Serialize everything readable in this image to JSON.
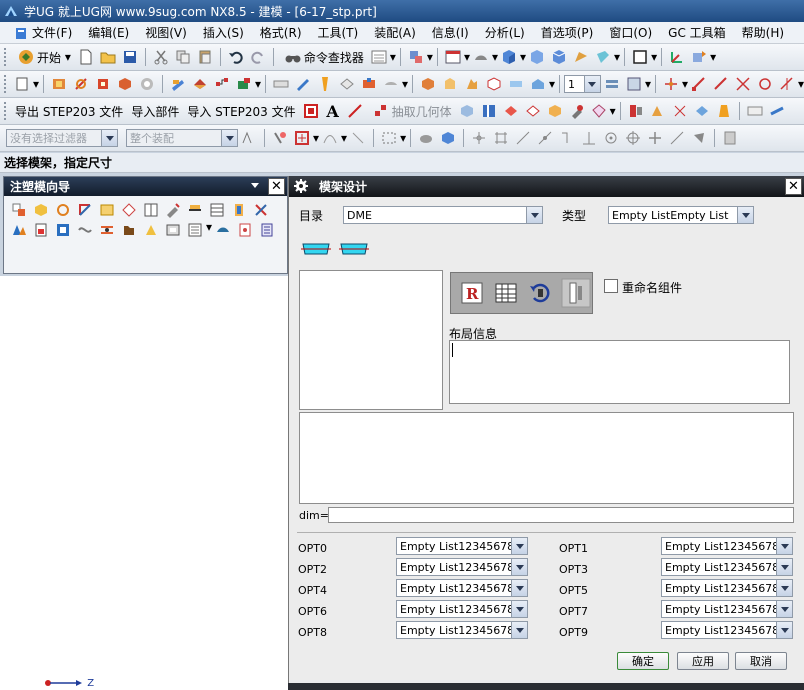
{
  "titlebar": {
    "text": "学UG 就上UG网  www.9sug.com NX8.5 - 建模 - [6-17_stp.prt]"
  },
  "menu": [
    {
      "label": "文件(F)"
    },
    {
      "label": "编辑(E)"
    },
    {
      "label": "视图(V)"
    },
    {
      "label": "插入(S)"
    },
    {
      "label": "格式(R)"
    },
    {
      "label": "工具(T)"
    },
    {
      "label": "装配(A)"
    },
    {
      "label": "信息(I)"
    },
    {
      "label": "分析(L)"
    },
    {
      "label": "首选项(P)"
    },
    {
      "label": "窗口(O)"
    },
    {
      "label": "GC 工具箱"
    },
    {
      "label": "帮助(H)"
    }
  ],
  "toolbar1": {
    "start": "开始",
    "command_finder": "命令查找器"
  },
  "toolbar2": {
    "layer_value": "1"
  },
  "toolbar3": {
    "export_step": "导出 STEP203 文件",
    "import_part": "导入部件",
    "import_step": "导入 STEP203 文件",
    "extract_geometry": "抽取几何体"
  },
  "toolbar4": {
    "filter_placeholder": "没有选择过滤器",
    "assembly_scope": "整个装配"
  },
  "status": {
    "prompt": "选择模架，指定尺寸"
  },
  "navigator": {
    "title": "注塑模向导"
  },
  "viewport": {
    "axis_label": "Z"
  },
  "dialog": {
    "title": "模架设计",
    "catalog_label": "目录",
    "catalog_value": "DME",
    "type_label": "类型",
    "type_value": "Empty ListEmpty List",
    "rename_label": "重命名组件",
    "layout_label": "布局信息",
    "dim_label": "dim=",
    "dim_value": "",
    "opts": [
      {
        "label": "OPT0",
        "value": "Empty List12345678"
      },
      {
        "label": "OPT1",
        "value": "Empty List12345678"
      },
      {
        "label": "OPT2",
        "value": "Empty List12345678"
      },
      {
        "label": "OPT3",
        "value": "Empty List12345678"
      },
      {
        "label": "OPT4",
        "value": "Empty List12345678"
      },
      {
        "label": "OPT5",
        "value": "Empty List12345678"
      },
      {
        "label": "OPT6",
        "value": "Empty List12345678"
      },
      {
        "label": "OPT7",
        "value": "Empty List12345678"
      },
      {
        "label": "OPT8",
        "value": "Empty List12345678"
      },
      {
        "label": "OPT9",
        "value": "Empty List12345678"
      }
    ],
    "ok": "确定",
    "apply": "应用",
    "cancel": "取消"
  }
}
